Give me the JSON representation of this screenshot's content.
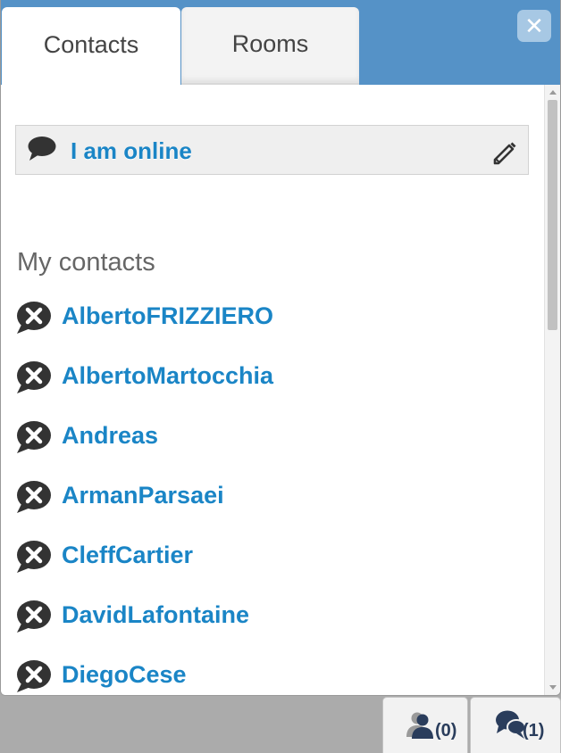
{
  "tabs": [
    {
      "label": "Contacts",
      "active": true
    },
    {
      "label": "Rooms",
      "active": false
    }
  ],
  "close_icon": "close-icon",
  "status": {
    "text": "I am online",
    "icon": "chat-bubble-icon",
    "edit_icon": "pencil-icon"
  },
  "contacts_section": {
    "title": "My contacts",
    "items": [
      {
        "name": "AlbertoFRIZZIERO",
        "status_icon": "offline-bubble-icon"
      },
      {
        "name": "AlbertoMartocchia",
        "status_icon": "offline-bubble-icon"
      },
      {
        "name": "Andreas",
        "status_icon": "offline-bubble-icon"
      },
      {
        "name": "ArmanParsaei",
        "status_icon": "offline-bubble-icon"
      },
      {
        "name": "CleffCartier",
        "status_icon": "offline-bubble-icon"
      },
      {
        "name": "DavidLafontaine",
        "status_icon": "offline-bubble-icon"
      },
      {
        "name": "DiegoCese",
        "status_icon": "offline-bubble-icon"
      }
    ]
  },
  "bottom_bar": {
    "contacts_count": "(0)",
    "chats_count": "(1)"
  },
  "colors": {
    "header_bg": "#5592c7",
    "link": "#1a85c6",
    "text_muted": "#666666"
  }
}
